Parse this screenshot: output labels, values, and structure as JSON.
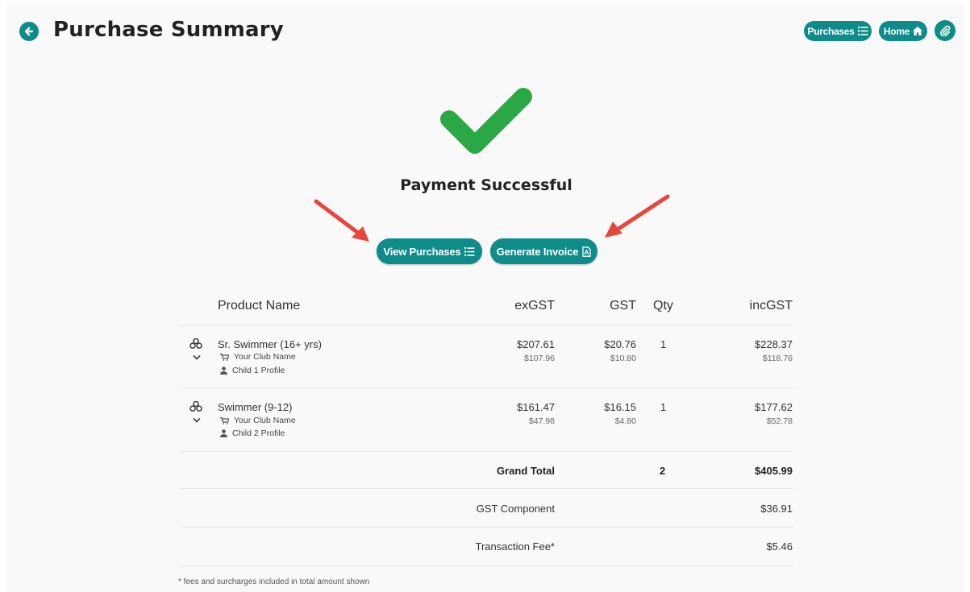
{
  "header": {
    "title": "Purchase Summary",
    "purchases_label": "Purchases",
    "home_label": "Home"
  },
  "status": {
    "message": "Payment Successful"
  },
  "actions": {
    "view_purchases_label": "View Purchases",
    "generate_invoice_label": "Generate Invoice"
  },
  "table": {
    "columns": {
      "product": "Product Name",
      "exgst": "exGST",
      "gst": "GST",
      "qty": "Qty",
      "incgst": "incGST"
    },
    "rows": [
      {
        "name": "Sr. Swimmer (16+ yrs)",
        "club": "Your Club Name",
        "profile": "Child 1 Profile",
        "exgst": "$207.61",
        "exgst_sub": "$107.96",
        "gst": "$20.76",
        "gst_sub": "$10.80",
        "qty": "1",
        "incgst": "$228.37",
        "incgst_sub": "$118.76"
      },
      {
        "name": "Swimmer (9-12)",
        "club": "Your Club Name",
        "profile": "Child 2 Profile",
        "exgst": "$161.47",
        "exgst_sub": "$47.98",
        "gst": "$16.15",
        "gst_sub": "$4.80",
        "qty": "1",
        "incgst": "$177.62",
        "incgst_sub": "$52.78"
      }
    ],
    "summary": {
      "grand_total_label": "Grand Total",
      "grand_total_qty": "2",
      "grand_total_value": "$405.99",
      "gst_component_label": "GST Component",
      "gst_component_value": "$36.91",
      "transaction_fee_label": "Transaction Fee*",
      "transaction_fee_value": "$5.46"
    }
  },
  "footnote": "* fees and surcharges included in total amount shown",
  "colors": {
    "accent": "#0e8c8a",
    "success": "#2aa845",
    "annotation_arrow": "#e8453c"
  },
  "icons": [
    "back-arrow-icon",
    "list-icon",
    "home-icon",
    "paperclip-icon",
    "checkmark-icon",
    "pdf-icon",
    "cubes-icon",
    "chevron-down-icon",
    "cart-icon",
    "user-icon"
  ]
}
